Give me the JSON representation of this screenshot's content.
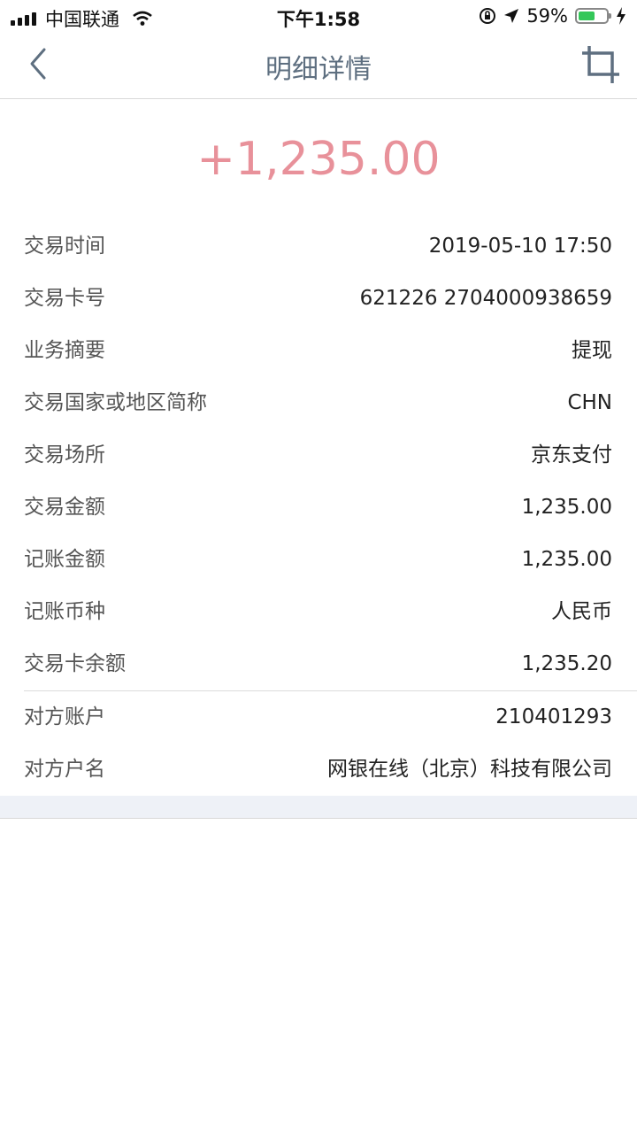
{
  "status_bar": {
    "carrier": "中国联通",
    "time": "下午1:58",
    "battery_percent": "59%",
    "battery_level": 0.59
  },
  "nav": {
    "title": "明细详情",
    "back_icon": "chevron-left-icon",
    "right_icon": "crop-icon"
  },
  "amount": "+1,235.00",
  "colors": {
    "amount": "#e8919a",
    "nav_title": "#5e6f80",
    "battery": "#34c759",
    "footer_band": "#eef1f7"
  },
  "details": [
    {
      "label": "交易时间",
      "value": "2019-05-10 17:50"
    },
    {
      "label": "交易卡号",
      "value": "621226 2704000938659"
    },
    {
      "label": "业务摘要",
      "value": "提现"
    },
    {
      "label": "交易国家或地区简称",
      "value": "CHN"
    },
    {
      "label": "交易场所",
      "value": "京东支付"
    },
    {
      "label": "交易金额",
      "value": "1,235.00"
    },
    {
      "label": "记账金额",
      "value": "1,235.00"
    },
    {
      "label": "记账币种",
      "value": "人民币"
    },
    {
      "label": "交易卡余额",
      "value": "1,235.20"
    }
  ],
  "counterparty": [
    {
      "label": "对方账户",
      "value": "210401293"
    },
    {
      "label": "对方户名",
      "value": "网银在线（北京）科技有限公司"
    }
  ]
}
